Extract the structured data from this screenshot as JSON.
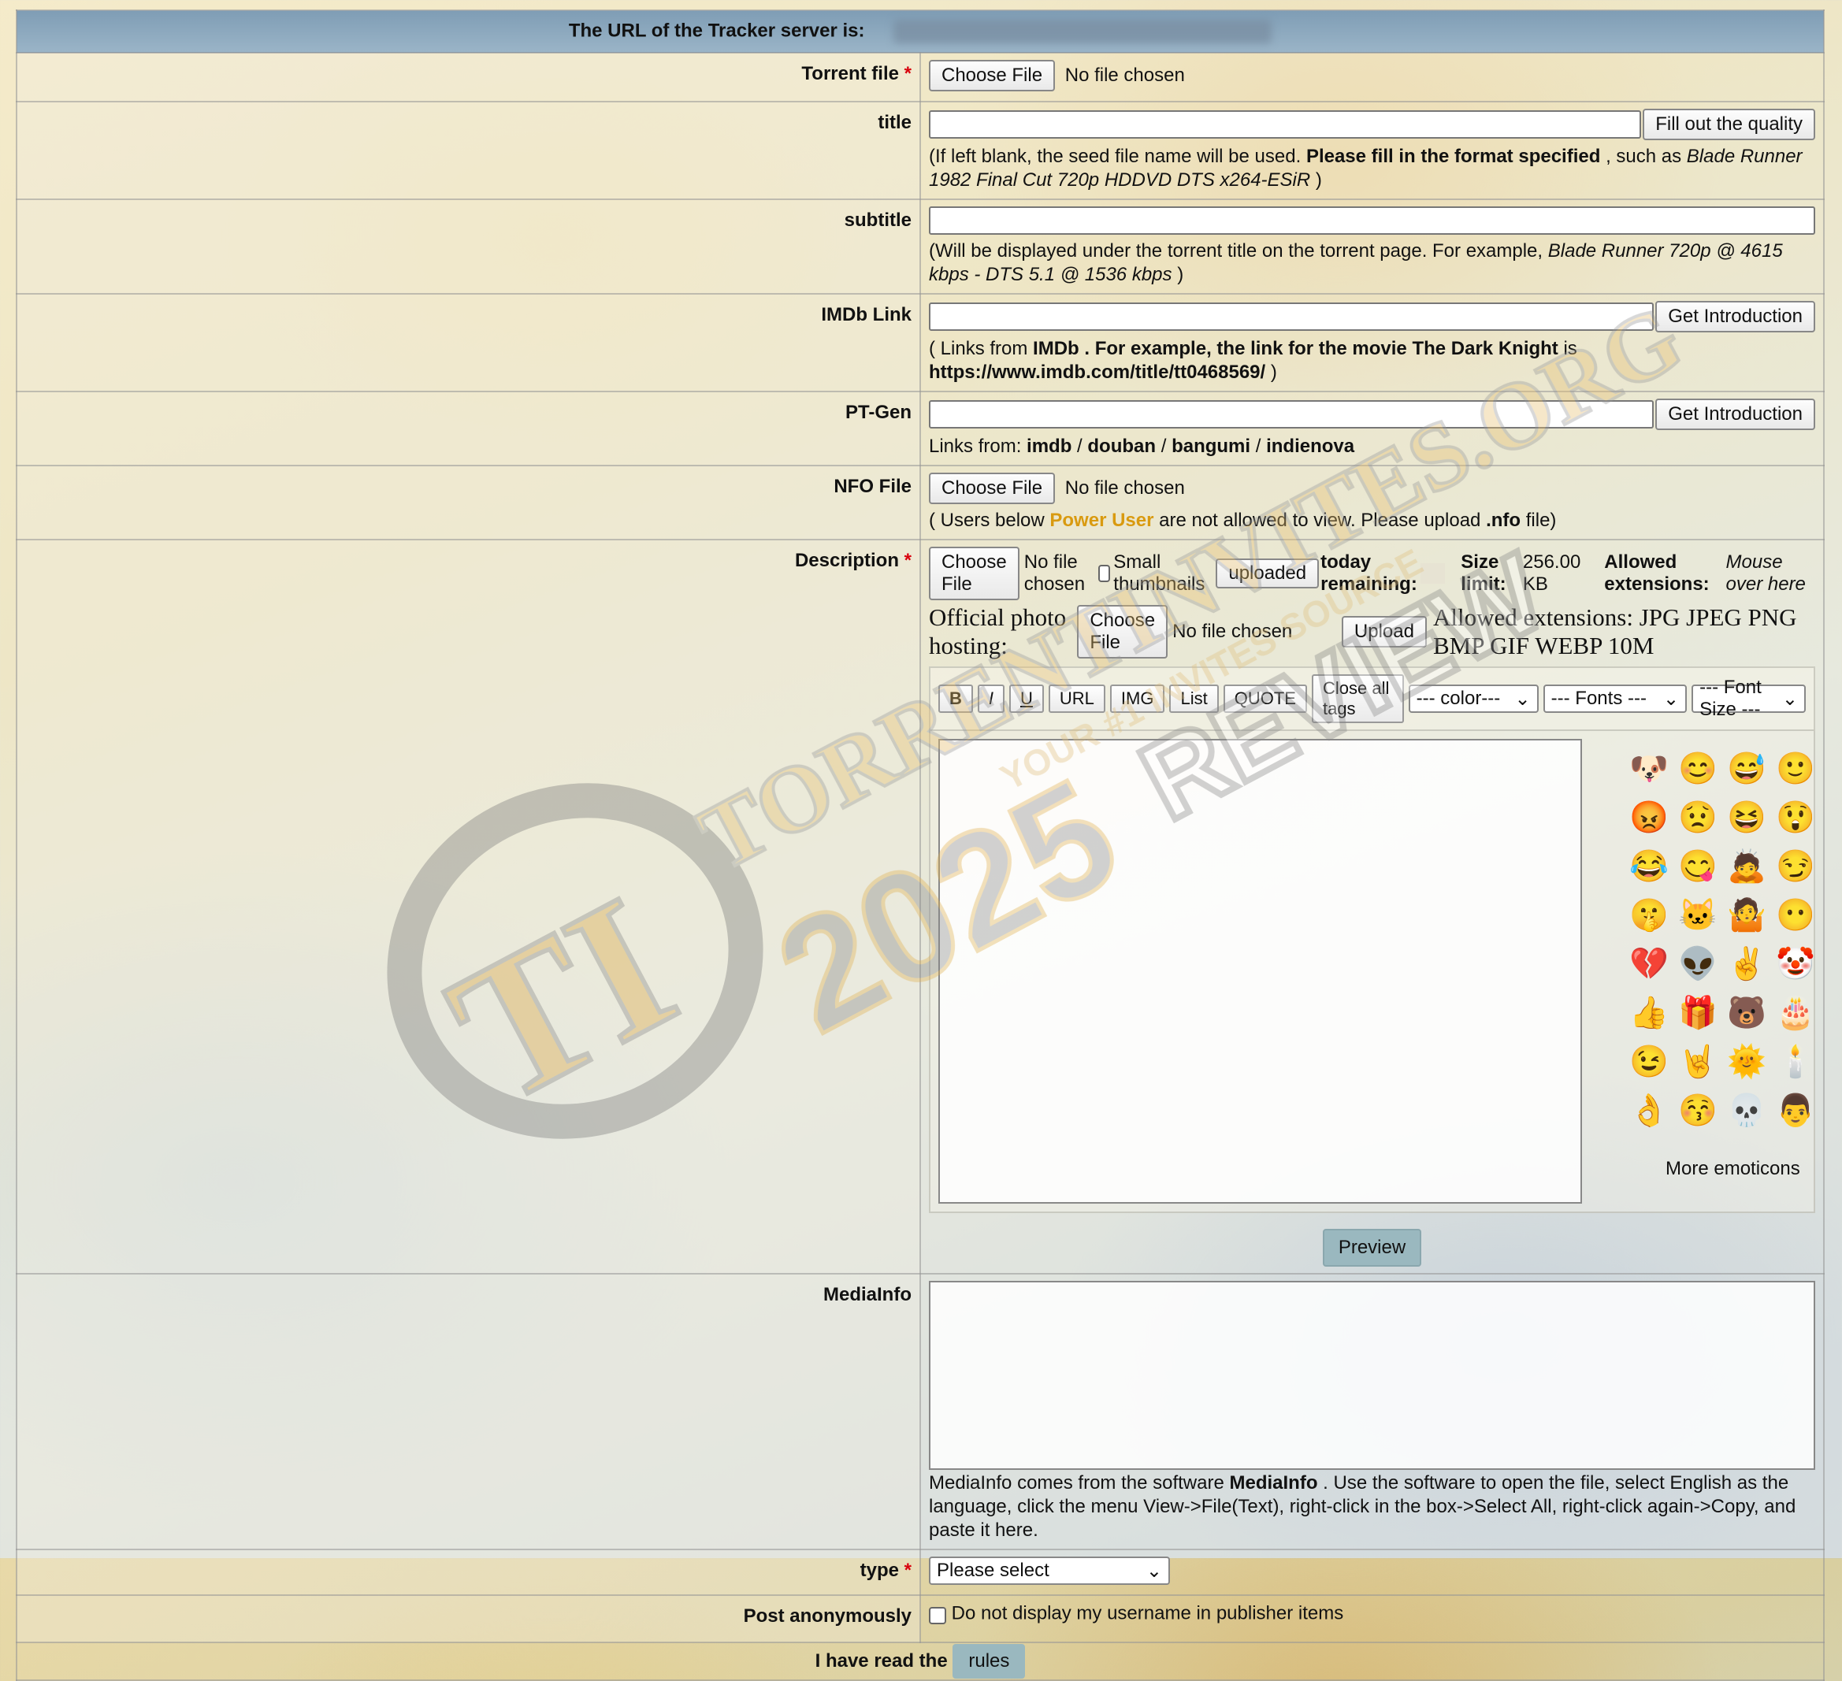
{
  "header": {
    "tracker_label": "The URL of the Tracker server is:"
  },
  "required_mark": "*",
  "file_input": {
    "button": "Choose File",
    "status": "No file chosen"
  },
  "torrent": {
    "label": "Torrent file"
  },
  "title": {
    "label": "title",
    "fill_button": "Fill out the quality",
    "note_1": "(If left blank, the seed file name will be used.",
    "note_bold": "Please fill in the format specified",
    "note_2": ", such as",
    "note_example": "Blade Runner 1982 Final Cut 720p HDDVD DTS x264-ESiR",
    "note_end": ")"
  },
  "subtitle": {
    "label": "subtitle",
    "note_1": "(Will be displayed under the torrent title on the torrent page. For example,",
    "note_example": "Blade Runner 720p @ 4615 kbps - DTS 5.1 @ 1536 kbps",
    "note_end": ")"
  },
  "imdb": {
    "label": "IMDb Link",
    "button": "Get Introduction",
    "note_1": "( Links from",
    "note_b1": "IMDb . For example, the link for the movie The Dark Knight",
    "note_2": "is",
    "note_b2": "https://www.imdb.com/title/tt0468569/",
    "note_end": ")"
  },
  "ptgen": {
    "label": "PT-Gen",
    "button": "Get Introduction",
    "note_prefix": "Links from:",
    "sources": [
      "imdb",
      "douban",
      "bangumi",
      "indienova"
    ],
    "sep": "/"
  },
  "nfo": {
    "label": "NFO File",
    "note_1": "( Users below",
    "note_gold": "Power User",
    "note_2": "are not allowed to view. Please upload",
    "note_b": ".nfo",
    "note_end": "file)"
  },
  "description": {
    "label": "Description",
    "small_thumbnails": "Small thumbnails",
    "uploaded_button": "uploaded",
    "today_remaining": "today remaining:",
    "size_limit_label": "Size limit:",
    "size_limit_value": "256.00 KB",
    "allowed_label": "Allowed extensions:",
    "allowed_value": "Mouse over here",
    "photo_hosting": "Official photo hosting:",
    "upload_button": "Upload",
    "photo_allowed": "Allowed extensions: JPG JPEG PNG BMP GIF WEBP 10M",
    "toolbar": {
      "bold": "B",
      "italic": "I",
      "underline": "U",
      "url": "URL",
      "img": "IMG",
      "list": "List",
      "quote": "QUOTE",
      "close_tags": "Close all tags",
      "color": "--- color---",
      "fonts": "--- Fonts ---",
      "font_size": "--- Font Size ---"
    },
    "more_emoticons": "More emoticons",
    "preview": "Preview"
  },
  "mediainfo": {
    "label": "MediaInfo",
    "note_1": "MediaInfo comes from the software",
    "note_b": "MediaInfo",
    "note_2": ". Use the software to open the file, select English as the language, click the menu View->File(Text), right-click in the box->Select All, right-click again->Copy, and paste it here."
  },
  "type": {
    "label": "type",
    "select_value": "Please select"
  },
  "anonymous": {
    "label": "Post anonymously",
    "checkbox_text": "Do not display my username in publisher items"
  },
  "footer": {
    "read_text": "I have read the",
    "rules_button": "rules"
  },
  "watermark": {
    "line1": "TORRENTINVITES.ORG",
    "line2": "YOUR #1 INVITES SOURCE",
    "year": "2025",
    "review": "REVIEW",
    "logo": "TI"
  },
  "emoticons": [
    "🐶",
    "😊",
    "😅",
    "🙂",
    "😡",
    "😟",
    "😆",
    "😲",
    "😂",
    "😋",
    "🙇",
    "😏",
    "🤫",
    "🐱",
    "🤷",
    "😶",
    "💔",
    "👽",
    "✌️",
    "🤡",
    "👍",
    "🎁",
    "🐻",
    "🎂",
    "😉",
    "🤘",
    "🌞",
    "🕯️",
    "👌",
    "😚",
    "💀",
    "👨"
  ],
  "colors": {
    "header_bg": "#8eabc0",
    "required": "#d8000c",
    "gold": "#d99a10",
    "accent_button": "#9ab8bf"
  }
}
